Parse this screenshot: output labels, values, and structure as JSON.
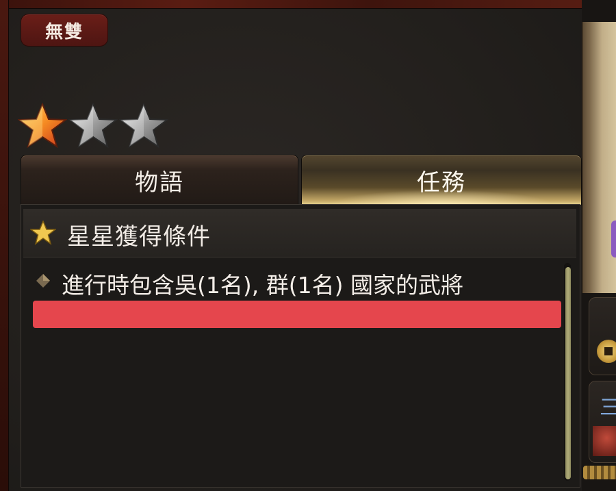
{
  "mode": {
    "label": "無雙"
  },
  "rating": {
    "earned": 1,
    "total": 3
  },
  "tabs": [
    {
      "label": "物語",
      "active": false
    },
    {
      "label": "任務",
      "active": true
    }
  ],
  "conditions": {
    "header": "星星獲得條件",
    "items": [
      {
        "text": "進行時包含吳(1名), 群(1名) 國家的武將"
      }
    ]
  },
  "colors": {
    "star_earned": "#f59a2a",
    "star_empty": "#a8a8a8",
    "redaction": "#e5464d",
    "scroll_thumb": "#b0ac78"
  },
  "right_panel": {
    "glyph": "三"
  }
}
